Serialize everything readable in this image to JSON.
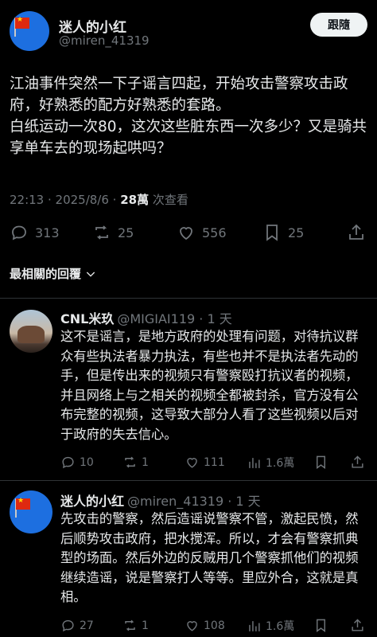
{
  "post": {
    "author": {
      "display_name": "迷人的小红",
      "handle": "@miren_41319"
    },
    "follow_label": "跟隨",
    "text": "江油事件突然一下子谣言四起，开始攻击警察攻击政府，好熟悉的配方好熟悉的套路。\n白纸运动一次80，这次这些脏东西一次多少？又是骑共享单车去的现场起哄吗？",
    "time": "22:13 · 2025/8/6 · ",
    "views": "28萬",
    "views_label": " 次查看",
    "counts": {
      "replies": "313",
      "reposts": "25",
      "likes": "556",
      "bookmarks": "25"
    }
  },
  "replies_header": "最相關的回覆",
  "replies": [
    {
      "display_name": "CNL米玖",
      "handle": "@MIGIAI119 · 1 天",
      "text": "这不是谣言，是地方政府的处理有问题，对待抗议群众有些执法者暴力执法，有些也并不是执法者先动的手，但是传出来的视频只有警察殴打抗议者的视频，并且网络上与之相关的视频全都被封杀，官方没有公布完整的视频，这导致大部分人看了这些视频以后对于政府的失去信心。",
      "counts": {
        "replies": "10",
        "reposts": "1",
        "likes": "111",
        "views": "1.6萬"
      }
    },
    {
      "display_name": "迷人的小红",
      "handle": "@miren_41319 · 1 天",
      "text": "先攻击的警察，然后造谣说警察不管，激起民愤，然后顺势攻击政府，把水搅浑。所以，才会有警察抓典型的场面。然后外边的反贼用几个警察抓他们的视频继续造谣，说是警察打人等等。里应外合，这就是真相。",
      "counts": {
        "replies": "27",
        "reposts": "1",
        "likes": "108",
        "views": "1.6萬"
      }
    }
  ],
  "icons": {
    "reply": "reply-icon",
    "repost": "repost-icon",
    "like": "heart-icon",
    "bookmark": "bookmark-icon",
    "share": "share-icon",
    "views": "views-icon",
    "chevron": "chevron-down-icon"
  }
}
